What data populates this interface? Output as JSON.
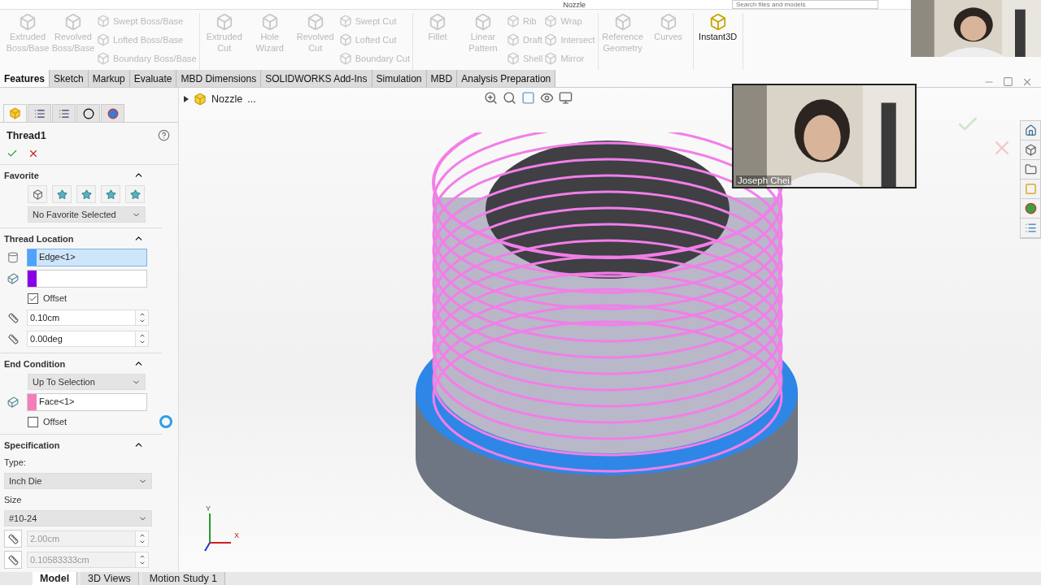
{
  "top_bar": {
    "title": "Nozzle",
    "search": {
      "placeholder": "Search files and models"
    }
  },
  "ribbon": {
    "groups": [
      {
        "large": [
          {
            "label": "Extruded Boss/Base",
            "disabled": true
          },
          {
            "label": "Revolved Boss/Base",
            "disabled": true
          }
        ],
        "small_columns": [
          [
            {
              "label": "Swept Boss/Base",
              "disabled": true
            },
            {
              "label": "Lofted Boss/Base",
              "disabled": true
            },
            {
              "label": "Boundary Boss/Base",
              "disabled": true
            }
          ]
        ]
      },
      {
        "large": [
          {
            "label": "Extruded Cut",
            "disabled": true
          },
          {
            "label": "Hole Wizard",
            "disabled": true
          },
          {
            "label": "Revolved Cut",
            "disabled": true
          }
        ],
        "small_columns": [
          [
            {
              "label": "Swept Cut",
              "disabled": true
            },
            {
              "label": "Lofted Cut",
              "disabled": true
            },
            {
              "label": "Boundary Cut",
              "disabled": true
            }
          ]
        ]
      },
      {
        "large": [
          {
            "label": "Fillet",
            "disabled": true
          },
          {
            "label": "Linear Pattern",
            "disabled": true
          }
        ],
        "small_columns": [
          [
            {
              "label": "Rib",
              "disabled": true
            },
            {
              "label": "Draft",
              "disabled": true
            },
            {
              "label": "Shell",
              "disabled": true
            }
          ],
          [
            {
              "label": "Wrap",
              "disabled": true
            },
            {
              "label": "Intersect",
              "disabled": true
            },
            {
              "label": "Mirror",
              "disabled": true
            }
          ]
        ]
      },
      {
        "large": [
          {
            "label": "Reference Geometry",
            "disabled": true
          },
          {
            "label": "Curves",
            "disabled": true
          }
        ]
      },
      {
        "large": [
          {
            "label": "Instant3D",
            "disabled": false
          }
        ]
      }
    ]
  },
  "tabs": [
    {
      "label": "Features",
      "selected": true
    },
    {
      "label": "Sketch",
      "selected": false
    },
    {
      "label": "Markup",
      "selected": false
    },
    {
      "label": "Evaluate",
      "selected": false
    },
    {
      "label": "MBD Dimensions",
      "selected": false
    },
    {
      "label": "SOLIDWORKS Add-Ins",
      "selected": false
    },
    {
      "label": "Simulation",
      "selected": false
    },
    {
      "label": "MBD",
      "selected": false
    },
    {
      "label": "Analysis Preparation",
      "selected": false
    }
  ],
  "property_manager": {
    "title": "Thread1",
    "sections": [
      {
        "title": "Favorite",
        "expanded": true,
        "rows": [
          {
            "kind": "favorites"
          },
          {
            "kind": "dropdown",
            "value": "No Favorite Selected",
            "indent": true
          }
        ]
      },
      {
        "title": "Thread Location",
        "expanded": true,
        "rows": [
          {
            "kind": "selection",
            "value": "Edge<1>",
            "color": "#4da3ff",
            "selected": true
          },
          {
            "kind": "selection",
            "value": "",
            "color": "#8a00e6",
            "selected": false
          },
          {
            "kind": "checkbox",
            "label": "Offset",
            "checked": true
          },
          {
            "kind": "spin",
            "value": "0.10cm",
            "disabled": false
          },
          {
            "kind": "spin",
            "value": "0.00deg",
            "disabled": false
          }
        ]
      },
      {
        "title": "End Condition",
        "expanded": true,
        "rows": [
          {
            "kind": "dropdown",
            "value": "Up To Selection",
            "indent": true
          },
          {
            "kind": "selection",
            "value": "Face<1>",
            "color": "#f47fb8",
            "selected": false
          },
          {
            "kind": "checkbox",
            "label": "Offset",
            "checked": false
          }
        ]
      },
      {
        "title": "Specification",
        "expanded": true,
        "rows": [
          {
            "kind": "label",
            "label": "Type:"
          },
          {
            "kind": "dropdown",
            "value": "Inch Die",
            "indent": false
          },
          {
            "kind": "label",
            "label": "Size"
          },
          {
            "kind": "dropdown",
            "value": "#10-24",
            "indent": false
          },
          {
            "kind": "spin",
            "value": "2.00cm",
            "disabled": true
          },
          {
            "kind": "spin",
            "value": "0.10583333cm",
            "disabled": true
          }
        ]
      }
    ]
  },
  "viewport": {
    "tree_root": "Nozzle",
    "tree_more": "...",
    "triad": {
      "y": "Y",
      "x": "X"
    }
  },
  "video_tiles": [
    {
      "kind": "picture"
    },
    {
      "kind": "picture",
      "name": "Joseph Chei"
    }
  ],
  "bottom_tabs": [
    {
      "label": "Model",
      "selected": true
    },
    {
      "label": "3D Views",
      "selected": false
    },
    {
      "label": "Motion Study 1",
      "selected": false
    }
  ]
}
